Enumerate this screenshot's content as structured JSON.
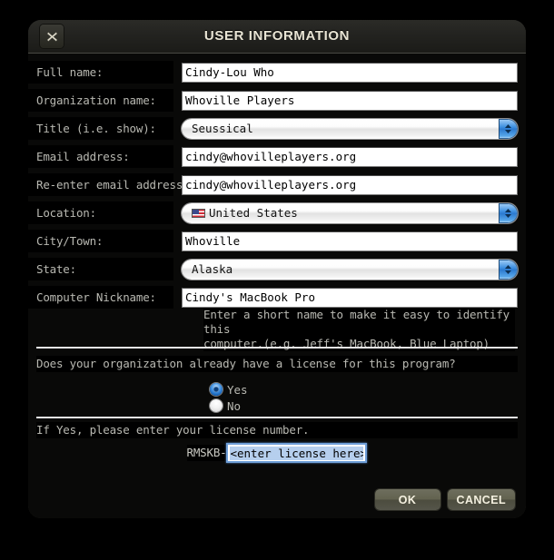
{
  "window": {
    "title": "USER INFORMATION",
    "close_icon": "close-icon"
  },
  "fields": [
    {
      "label": "Full name:",
      "type": "text",
      "value": "Cindy-Lou Who"
    },
    {
      "label": "Organization name:",
      "type": "text",
      "value": "Whoville Players"
    },
    {
      "label": "Title (i.e. show):",
      "type": "popup",
      "value": "Seussical"
    },
    {
      "label": "Email address:",
      "type": "text",
      "value": "cindy@whovilleplayers.org"
    },
    {
      "label": "Re-enter email address:",
      "type": "text",
      "value": "cindy@whovilleplayers.org"
    },
    {
      "label": "Location:",
      "type": "popup",
      "value": "United States",
      "icon": "us-flag-icon"
    },
    {
      "label": "City/Town:",
      "type": "text",
      "value": "Whoville"
    },
    {
      "label": "State:",
      "type": "popup",
      "value": "Alaska"
    },
    {
      "label": "Computer Nickname:",
      "type": "text",
      "value": "Cindy's MacBook Pro"
    }
  ],
  "nickname_note": {
    "line1": "Enter a short name to make it easy to identify this",
    "line2": "computer.(e.g. Jeff's MacBook, Blue Laptop)"
  },
  "license": {
    "question": "Does your organization already have a license for this program?",
    "options": [
      {
        "label": "Yes",
        "selected": true
      },
      {
        "label": "No",
        "selected": false
      }
    ],
    "prompt": "If Yes, please enter your license number.",
    "prefix": "RMSKB-",
    "input_value": "<enter license here>"
  },
  "buttons": {
    "ok": "OK",
    "cancel": "CANCEL"
  },
  "colors": {
    "accent_blue": "#3d8fe0",
    "button_olive": "#63634f",
    "title_text": "#e8e4d4"
  }
}
